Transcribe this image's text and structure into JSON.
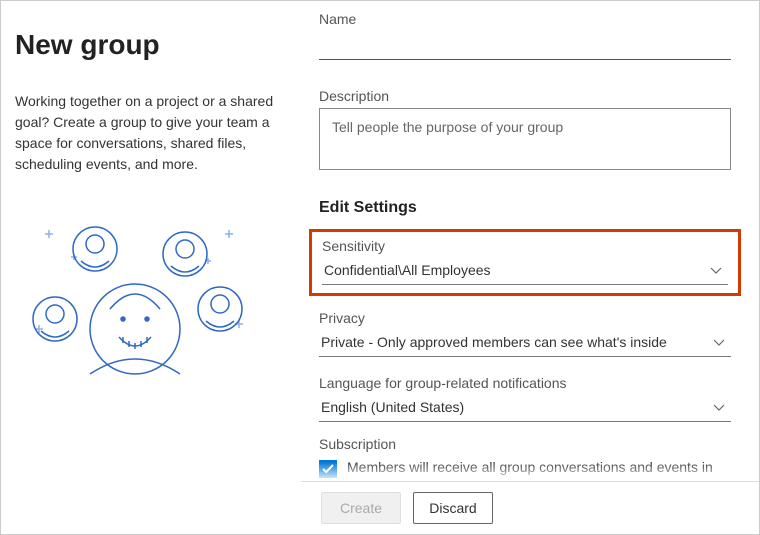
{
  "left": {
    "title": "New group",
    "description": "Working together on a project or a shared goal? Create a group to give your team a space for conversations, shared files, scheduling events, and more."
  },
  "form": {
    "name_label": "Name",
    "name_value": "",
    "desc_label": "Description",
    "desc_placeholder": "Tell people the purpose of your group",
    "desc_value": "",
    "settings_heading": "Edit Settings",
    "sensitivity": {
      "label": "Sensitivity",
      "value": "Confidential\\All Employees"
    },
    "privacy": {
      "label": "Privacy",
      "value": "Private - Only approved members can see what's inside"
    },
    "language": {
      "label": "Language for group-related notifications",
      "value": "English (United States)"
    },
    "subscription": {
      "label": "Subscription",
      "checked": true,
      "text": "Members will receive all group conversations and events in their inboxes. They can stop following this group later if they"
    }
  },
  "footer": {
    "create_label": "Create",
    "discard_label": "Discard"
  }
}
